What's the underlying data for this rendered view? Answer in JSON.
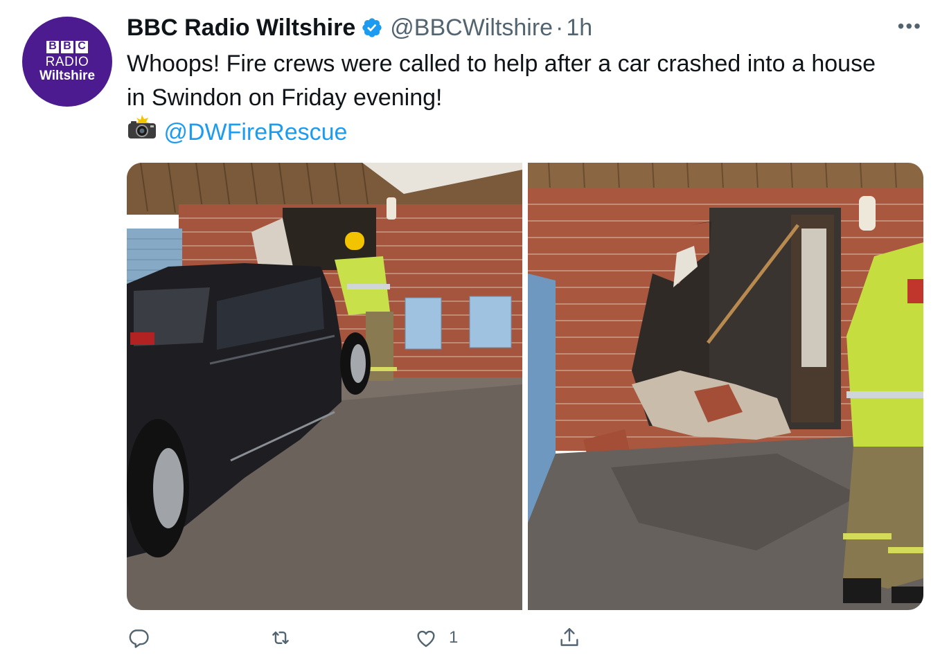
{
  "account": {
    "display_name": "BBC Radio Wiltshire",
    "handle": "@BBCWiltshire",
    "separator": "·",
    "time": "1h",
    "verified": true,
    "avatar": {
      "logo_letters": [
        "B",
        "B",
        "C"
      ],
      "line1": "RADIO",
      "line2": "Wiltshire",
      "color": "#4b1b8f"
    }
  },
  "tweet": {
    "text_line1": "Whoops! Fire crews were called to help after a car crashed into a house",
    "text_line2": "in Swindon on Friday evening!",
    "camera_icon": "camera-with-flash-icon",
    "mention": "@DWFireRescue",
    "mention_color": "#1d9bf0"
  },
  "media": {
    "photos": [
      {
        "name": "car-crashed-into-house-photo"
      },
      {
        "name": "damaged-wall-photo"
      }
    ]
  },
  "actions": {
    "reply_icon": "reply-icon",
    "retweet_icon": "retweet-icon",
    "like_icon": "heart-icon",
    "like_count": "1",
    "share_icon": "share-icon"
  },
  "more_label": "•••"
}
